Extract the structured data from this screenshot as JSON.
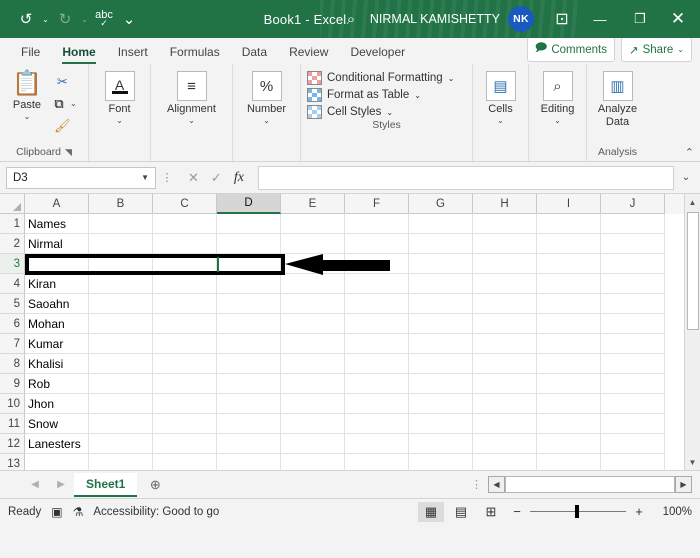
{
  "titlebar": {
    "quick_access": [
      {
        "name": "undo-button",
        "glyph": "↺"
      },
      {
        "name": "redo-button",
        "glyph": "↻"
      },
      {
        "name": "spelling-button",
        "glyph": "abc"
      },
      {
        "name": "customize-qat-button",
        "glyph": "⌄"
      }
    ],
    "document_title": "Book1 - Excel",
    "search_icon": "⌕",
    "account_name": "NIRMAL KAMISHETTY",
    "avatar_initials": "NK",
    "ribbon_display_icon": "⊡",
    "minimize": "—",
    "maximize": "❐",
    "close": "✕",
    "brand_color": "#217346",
    "avatar_color": "#185abd"
  },
  "tabs": [
    {
      "label": "File",
      "active": false
    },
    {
      "label": "Home",
      "active": true
    },
    {
      "label": "Insert",
      "active": false
    },
    {
      "label": "Formulas",
      "active": false
    },
    {
      "label": "Data",
      "active": false
    },
    {
      "label": "Review",
      "active": false
    },
    {
      "label": "Developer",
      "active": false
    }
  ],
  "tab_actions": {
    "comments_label": "Comments",
    "comments_icon": "🗩",
    "share_label": "Share",
    "share_icon": "↗",
    "share_caret": "⌄"
  },
  "ribbon": {
    "clipboard": {
      "paste_label": "Paste",
      "paste_caret": "⌄",
      "cut_icon": "✂",
      "copy_icon": "⧉",
      "copy_caret": "⌄",
      "format_painter_icon": "🖌",
      "group_label": "Clipboard",
      "dialog_launcher": "⌄"
    },
    "font": {
      "label": "Font",
      "icon": "A",
      "caret": "⌄"
    },
    "alignment": {
      "label": "Alignment",
      "icon": "≡",
      "caret": "⌄"
    },
    "number": {
      "label": "Number",
      "icon": "%",
      "caret": "⌄"
    },
    "styles": {
      "group_label": "Styles",
      "items": [
        {
          "label": "Conditional Formatting",
          "caret": "⌄"
        },
        {
          "label": "Format as Table",
          "caret": "⌄"
        },
        {
          "label": "Cell Styles",
          "caret": "⌄"
        }
      ]
    },
    "cells": {
      "label": "Cells",
      "icon": "▤",
      "caret": "⌄"
    },
    "editing": {
      "label": "Editing",
      "icon": "⌕",
      "caret": "⌄"
    },
    "analysis": {
      "group_label": "Analysis",
      "button_line1": "Analyze",
      "button_line2": "Data",
      "icon": "▥"
    },
    "collapse_icon": "⌃"
  },
  "formula_bar": {
    "name_box_value": "D3",
    "name_box_caret": "▼",
    "more_dots": "⋮",
    "cancel_icon": "✕",
    "enter_icon": "✓",
    "fx_icon": "fx",
    "formula_value": "",
    "expand_caret": "⌄"
  },
  "grid": {
    "columns": [
      "A",
      "B",
      "C",
      "D",
      "E",
      "F",
      "G",
      "H",
      "I",
      "J"
    ],
    "active_column": "D",
    "active_row": 3,
    "rows": [
      {
        "num": "1",
        "cells": [
          "Names",
          "",
          "",
          "",
          "",
          "",
          "",
          "",
          "",
          ""
        ]
      },
      {
        "num": "2",
        "cells": [
          "Nirmal",
          "",
          "",
          "",
          "",
          "",
          "",
          "",
          "",
          ""
        ]
      },
      {
        "num": "3",
        "cells": [
          "",
          "",
          "",
          "",
          "",
          "",
          "",
          "",
          "",
          ""
        ]
      },
      {
        "num": "4",
        "cells": [
          "Kiran",
          "",
          "",
          "",
          "",
          "",
          "",
          "",
          "",
          ""
        ]
      },
      {
        "num": "5",
        "cells": [
          "Saoahn",
          "",
          "",
          "",
          "",
          "",
          "",
          "",
          "",
          ""
        ]
      },
      {
        "num": "6",
        "cells": [
          "Mohan",
          "",
          "",
          "",
          "",
          "",
          "",
          "",
          "",
          ""
        ]
      },
      {
        "num": "7",
        "cells": [
          "Kumar",
          "",
          "",
          "",
          "",
          "",
          "",
          "",
          "",
          ""
        ]
      },
      {
        "num": "8",
        "cells": [
          "Khalisi",
          "",
          "",
          "",
          "",
          "",
          "",
          "",
          "",
          ""
        ]
      },
      {
        "num": "9",
        "cells": [
          "Rob",
          "",
          "",
          "",
          "",
          "",
          "",
          "",
          "",
          ""
        ]
      },
      {
        "num": "10",
        "cells": [
          "Jhon",
          "",
          "",
          "",
          "",
          "",
          "",
          "",
          "",
          ""
        ]
      },
      {
        "num": "11",
        "cells": [
          "Snow",
          "",
          "",
          "",
          "",
          "",
          "",
          "",
          "",
          ""
        ]
      },
      {
        "num": "12",
        "cells": [
          "Lanesters",
          "",
          "",
          "",
          "",
          "",
          "",
          "",
          "",
          ""
        ]
      },
      {
        "num": "13",
        "cells": [
          "",
          "",
          "",
          "",
          "",
          "",
          "",
          "",
          "",
          ""
        ]
      }
    ],
    "vscroll_up": "▲",
    "vscroll_down": "▼"
  },
  "annotation": {
    "highlight_color": "#000000",
    "arrow_color": "#000000"
  },
  "sheetbar": {
    "prev_icon": "◀",
    "next_icon": "▶",
    "sheets": [
      {
        "label": "Sheet1",
        "active": true
      }
    ],
    "add_sheet_icon": "⊕",
    "more_dots": "⋮",
    "hscroll_left": "◀",
    "hscroll_right": "▶"
  },
  "statusbar": {
    "mode": "Ready",
    "macro_icon": "▣",
    "accessibility_icon": "⚗",
    "accessibility_text": "Accessibility: Good to go",
    "view_normal_icon": "▦",
    "view_pagelayout_icon": "▤",
    "view_pagebreak_icon": "⊞",
    "zoom_out": "−",
    "zoom_in": "+",
    "zoom_level": "100%"
  }
}
